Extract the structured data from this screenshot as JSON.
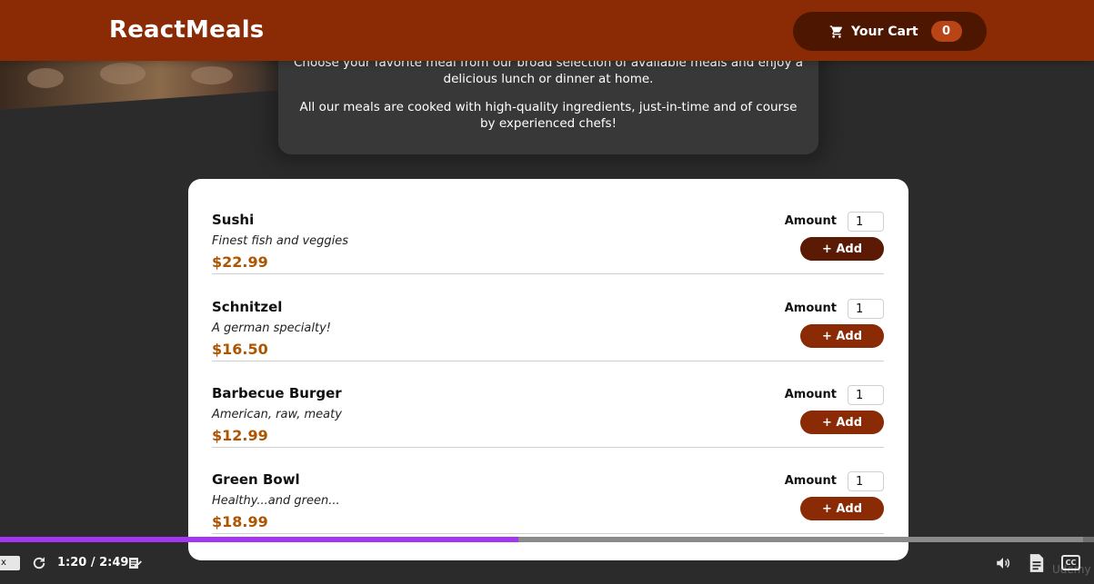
{
  "header": {
    "brand": "ReactMeals",
    "cart": {
      "label": "Your Cart",
      "count": "0",
      "icon": "cart-icon"
    }
  },
  "summary": {
    "paragraph1": "Choose your favorite meal from our broad selection of available meals and enjoy a delicious lunch or dinner at home.",
    "paragraph2": "All our meals are cooked with high-quality ingredients, just-in-time and of course by experienced chefs!"
  },
  "meals": [
    {
      "name": "Sushi",
      "description": "Finest fish and veggies",
      "price": "$22.99",
      "amount_label": "Amount",
      "amount_value": "1",
      "add_label": "+ Add"
    },
    {
      "name": "Schnitzel",
      "description": "A german specialty!",
      "price": "$16.50",
      "amount_label": "Amount",
      "amount_value": "1",
      "add_label": "+ Add"
    },
    {
      "name": "Barbecue Burger",
      "description": "American, raw, meaty",
      "price": "$12.99",
      "amount_label": "Amount",
      "amount_value": "1",
      "add_label": "+ Add"
    },
    {
      "name": "Green Bowl",
      "description": "Healthy...and green...",
      "price": "$18.99",
      "amount_label": "Amount",
      "amount_value": "1",
      "add_label": "+ Add"
    }
  ],
  "player": {
    "speed_label": "x",
    "time": "1:20 / 2:49",
    "progress_fraction": 0.4734,
    "watermark": "Udemy"
  },
  "colors": {
    "header": "#8a2b06",
    "cart_button": "#4d1601",
    "badge": "#b94517",
    "price": "#ad5502",
    "progress": "#a435f0"
  }
}
